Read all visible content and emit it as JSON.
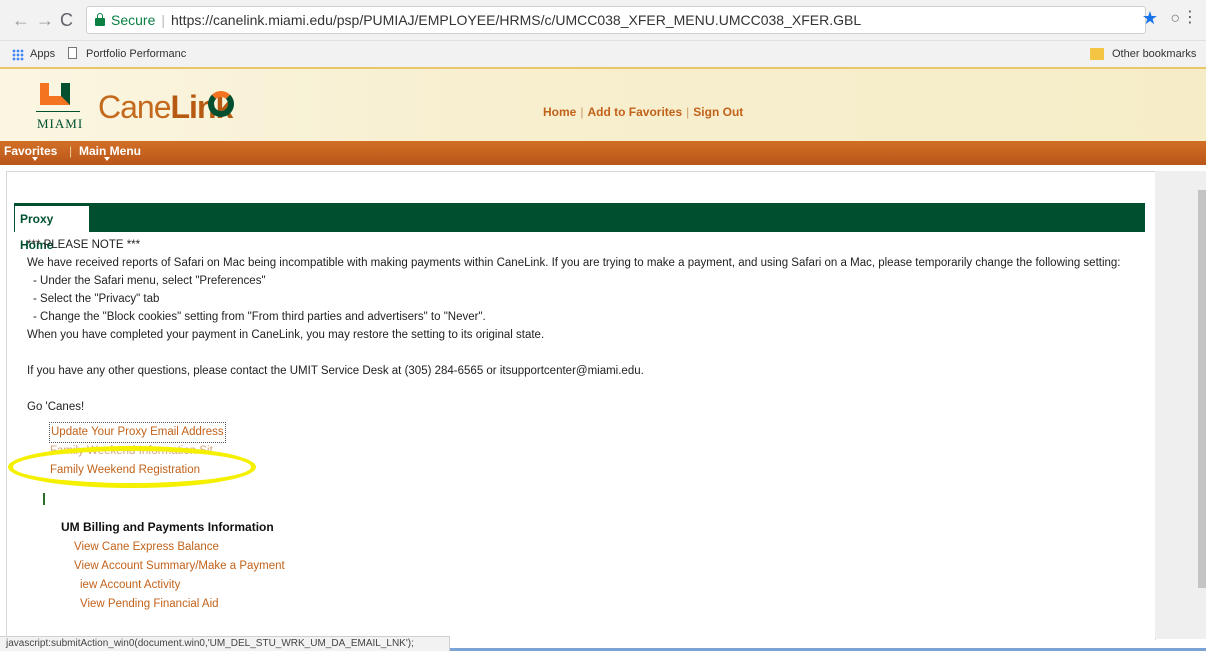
{
  "browser": {
    "secure_label": "Secure",
    "url": "https://canelink.miami.edu/psp/PUMIAJ/EMPLOYEE/HRMS/c/UMCC038_XFER_MENU.UMCC038_XFER.GBL",
    "bookmarks": {
      "apps": "Apps",
      "portfolio": "Portfolio Performanc",
      "other": "Other bookmarks"
    },
    "status_text": "javascript:submitAction_win0(document.win0,'UM_DEL_STU_WRK_UM_DA_EMAIL_LNK');"
  },
  "header": {
    "logo_word": "MIAMI",
    "app_name_light": "Cane",
    "app_name_bold": "Link",
    "links": {
      "home": "Home",
      "favorites": "Add to Favorites",
      "signout": "Sign Out"
    }
  },
  "menubar": {
    "favorites": "Favorites",
    "main_menu": "Main Menu"
  },
  "tabs": {
    "active": "Proxy Home"
  },
  "notice": {
    "heading": "*** PLEASE NOTE ***",
    "line1": "We have received reports of Safari on Mac being incompatible with making payments within CaneLink.  If you are trying to make a payment, and using Safari on a Mac, please temporarily change the following setting:",
    "step1": "- Under the Safari menu, select \"Preferences\"",
    "step2": "- Select the \"Privacy\" tab",
    "step3": "- Change the \"Block cookies\" setting from \"From third parties and advertisers\" to \"Never\".",
    "line2": "When you have completed your payment in CaneLink, you may restore the setting to its original state.",
    "contact": "If you have any other questions, please contact the UMIT Service Desk at (305) 284-6565 or itsupportcenter@miami.edu.",
    "signoff": "Go 'Canes!"
  },
  "proxy_links": {
    "update_email": "Update Your Proxy Email Address",
    "family_weekend_info": "Family Weekend Information Sit",
    "family_weekend_registration": "Family Weekend Registration"
  },
  "billing": {
    "heading": "UM Billing and Payments Information",
    "cane_express": "View Cane Express Balance",
    "account_summary": "View Account Summary/Make a Payment",
    "account_activity": "iew Account Activity",
    "pending_aid": "View Pending Financial Aid"
  },
  "colors": {
    "um_green": "#005030",
    "um_orange": "#f47321",
    "link_orange": "#c2621a",
    "highlight": "#f4f000"
  }
}
